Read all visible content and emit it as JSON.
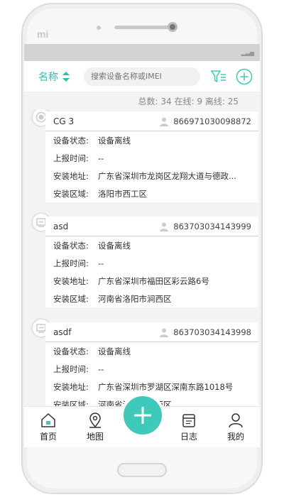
{
  "phone": {
    "brand": "mi"
  },
  "topbar": {
    "sort_label": "名称",
    "search_placeholder": "搜索设备名称或IMEI"
  },
  "summary": {
    "total_label": "总数:",
    "total": "34",
    "online_label": "在线:",
    "online": "9",
    "offline_label": "离线:",
    "offline": "25"
  },
  "labels": {
    "status": "设备状态:",
    "report_time": "上报时间:",
    "address": "安装地址:",
    "area": "安装区域:"
  },
  "devices": [
    {
      "name": "CG 3",
      "imei": "866971030098872",
      "status": "设备离线",
      "report_time": "--",
      "address": "广东省深圳市龙岗区龙翔大道与德政...",
      "area": "洛阳市西工区"
    },
    {
      "name": "asd",
      "imei": "863703034143999",
      "status": "设备离线",
      "report_time": "--",
      "address": "广东省深圳市福田区彩云路6号",
      "area": "河南省洛阳市涧西区"
    },
    {
      "name": "asdf",
      "imei": "863703034143998",
      "status": "设备离线",
      "report_time": "--",
      "address": "广东省深圳市罗湖区深南东路1018号",
      "area": "河南省洛阳市涧西区"
    }
  ],
  "tabs": {
    "home": "首页",
    "map": "地图",
    "log": "日志",
    "mine": "我的"
  },
  "colors": {
    "accent": "#3ec9ba",
    "text": "#333333"
  }
}
